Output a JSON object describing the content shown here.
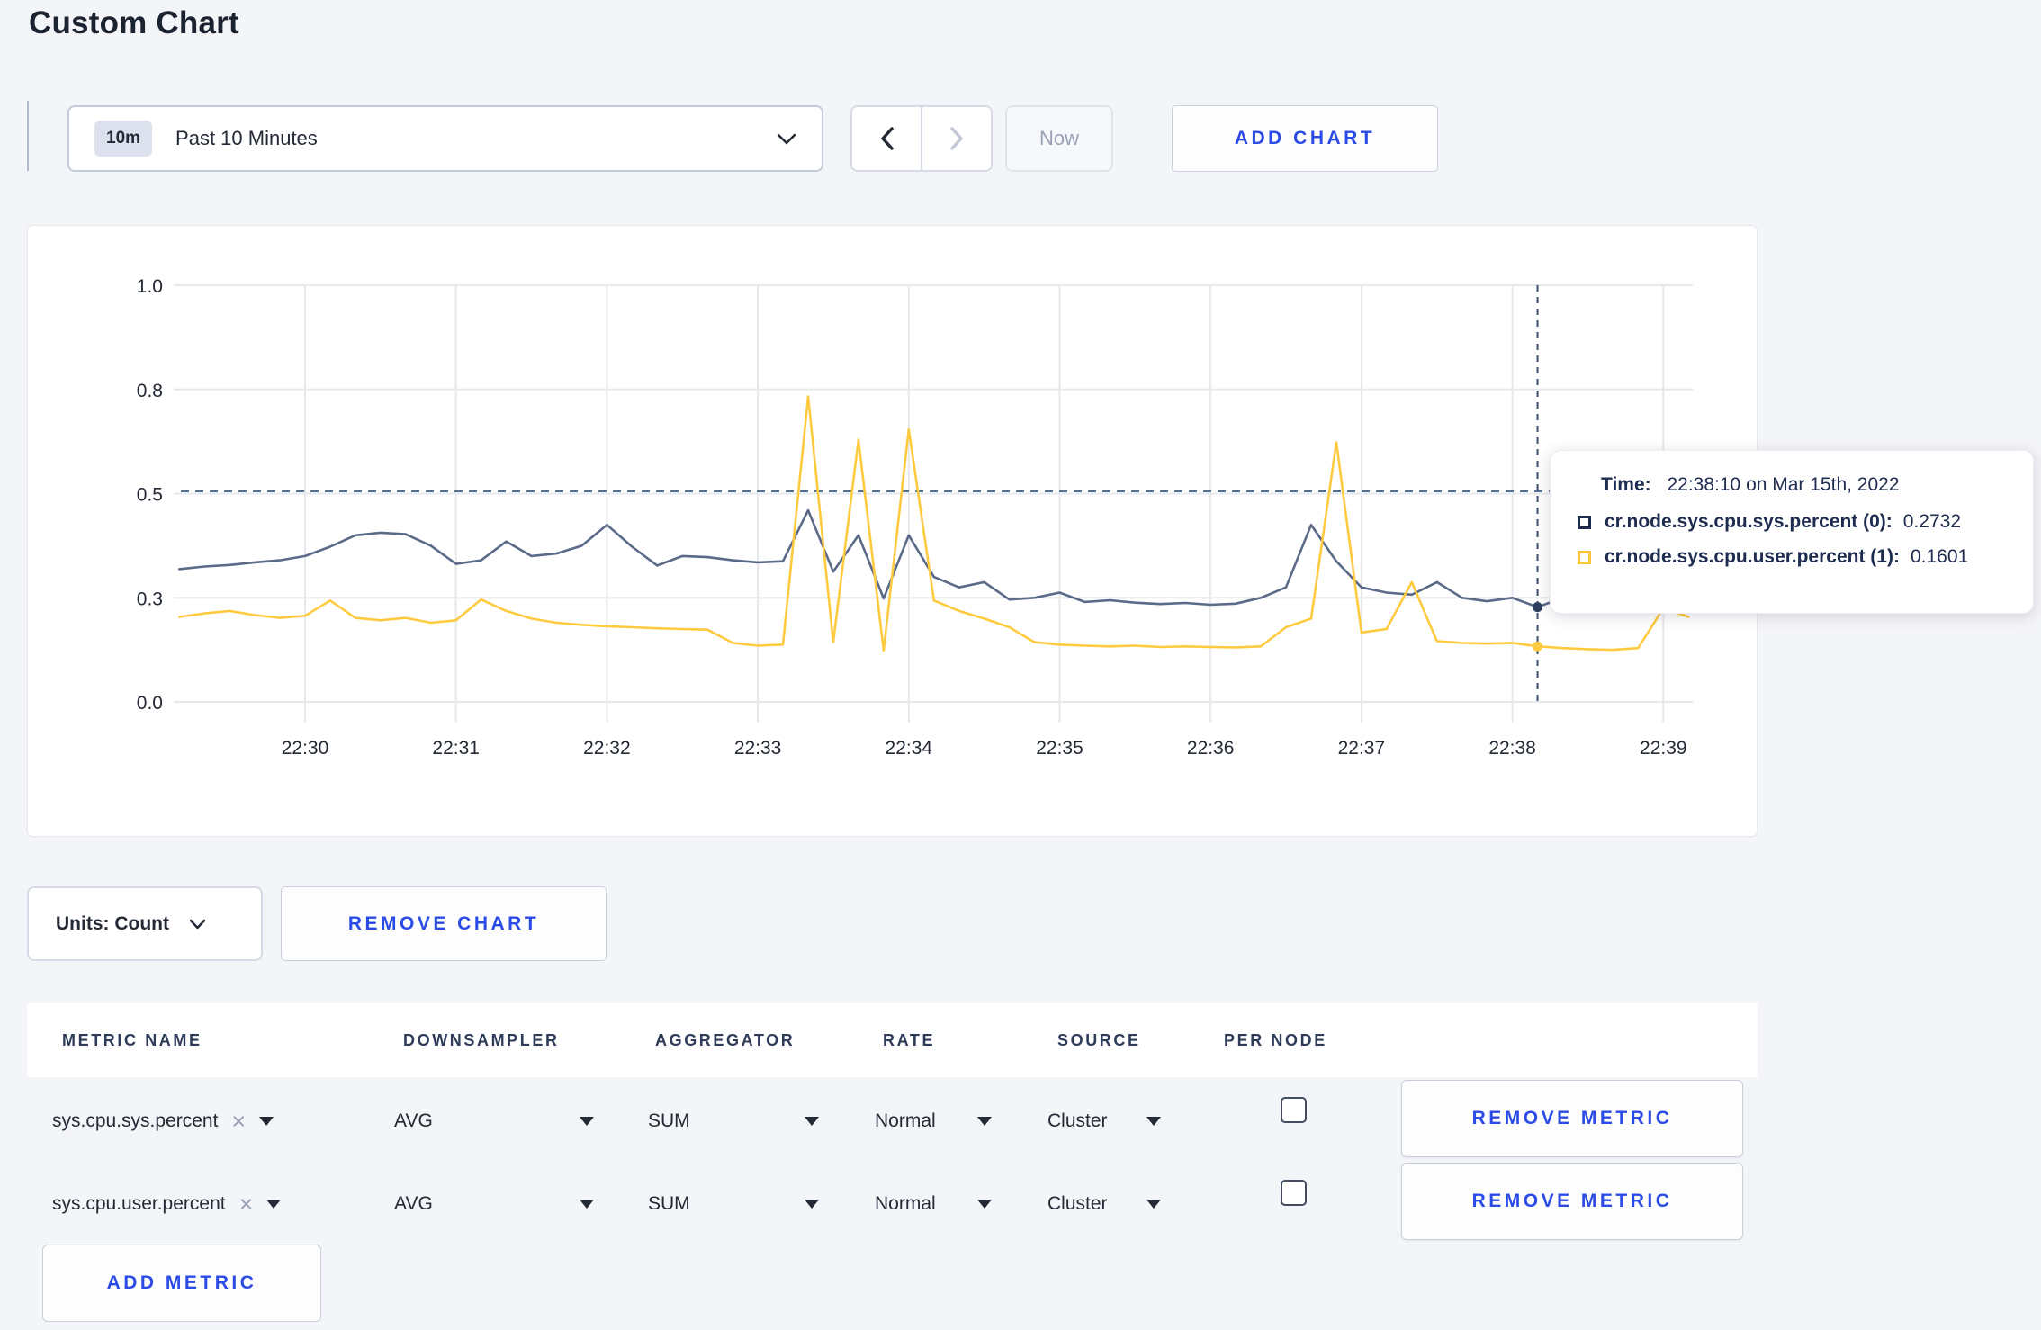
{
  "page": {
    "title": "Custom Chart"
  },
  "toolbar": {
    "time_badge": "10m",
    "time_label": "Past 10 Minutes",
    "now_label": "Now",
    "add_chart_label": "ADD CHART"
  },
  "chart_data": {
    "type": "line",
    "title": "",
    "xlabel": "",
    "ylabel": "",
    "ylim": [
      0.0,
      1.0
    ],
    "grid": true,
    "y_ticks": {
      "values": [
        1.0,
        0.8,
        0.5,
        0.3,
        0.0
      ],
      "labels": [
        "1.0",
        "0.8",
        "0.5",
        "0.3",
        "0.0"
      ]
    },
    "x_ticks": [
      "22:30",
      "22:31",
      "22:32",
      "22:33",
      "22:34",
      "22:35",
      "22:36",
      "22:37",
      "22:38",
      "22:39"
    ],
    "time_start": "22:29:10",
    "time_step_seconds": 10,
    "series": [
      {
        "name": "cr.node.sys.cpu.sys.percent (0)",
        "color": "#5a6a88",
        "values": [
          0.355,
          0.36,
          0.363,
          0.368,
          0.372,
          0.38,
          0.398,
          0.42,
          0.425,
          0.422,
          0.4,
          0.365,
          0.372,
          0.408,
          0.38,
          0.385,
          0.4,
          0.44,
          0.398,
          0.362,
          0.38,
          0.378,
          0.372,
          0.368,
          0.37,
          0.468,
          0.35,
          0.42,
          0.298,
          0.42,
          0.34,
          0.32,
          0.33,
          0.295,
          0.3,
          0.31,
          0.288,
          0.293,
          0.286,
          0.282,
          0.285,
          0.28,
          0.283,
          0.3,
          0.32,
          0.44,
          0.37,
          0.32,
          0.31,
          0.306,
          0.33,
          0.3,
          0.29,
          0.3,
          0.2732,
          0.3,
          0.31,
          0.325,
          0.305,
          0.298,
          0.32
        ]
      },
      {
        "name": "cr.node.sys.cpu.user.percent (1)",
        "color": "#fdca40",
        "values": [
          0.245,
          0.255,
          0.262,
          0.25,
          0.242,
          0.248,
          0.292,
          0.242,
          0.235,
          0.242,
          0.228,
          0.235,
          0.295,
          0.262,
          0.24,
          0.228,
          0.222,
          0.218,
          0.215,
          0.212,
          0.21,
          0.208,
          0.17,
          0.162,
          0.165,
          0.78,
          0.172,
          0.655,
          0.148,
          0.685,
          0.292,
          0.262,
          0.24,
          0.215,
          0.172,
          0.165,
          0.162,
          0.16,
          0.162,
          0.158,
          0.16,
          0.158,
          0.157,
          0.16,
          0.215,
          0.24,
          0.648,
          0.2,
          0.21,
          0.33,
          0.175,
          0.17,
          0.168,
          0.17,
          0.1601,
          0.155,
          0.152,
          0.15,
          0.155,
          0.27,
          0.245
        ]
      }
    ],
    "crosshair": {
      "index": 54,
      "time": "22:38:10",
      "hline_value": 0.507
    },
    "colors": {
      "gridline": "#e7e8eb",
      "crosshair_v": "#3d4f6d",
      "crosshair_h": "#4e7195",
      "dot_sys": "#2c3d5e",
      "dot_user": "#fdca40"
    },
    "legend_position": "tooltip"
  },
  "tooltip": {
    "time_label": "Time:",
    "time_value": "22:38:10 on Mar 15th, 2022",
    "series": [
      {
        "label": "cr.node.sys.cpu.sys.percent (0):",
        "value": "0.2732",
        "color": "#1c2b4a"
      },
      {
        "label": "cr.node.sys.cpu.user.percent (1):",
        "value": "0.1601",
        "color": "#fdc53a"
      }
    ]
  },
  "chart_footer": {
    "units_label": "Units: Count",
    "remove_chart_label": "REMOVE CHART"
  },
  "metrics_table": {
    "headers": [
      "METRIC NAME",
      "DOWNSAMPLER",
      "AGGREGATOR",
      "RATE",
      "SOURCE",
      "PER NODE"
    ],
    "rows": [
      {
        "metric": "sys.cpu.sys.percent",
        "downsampler": "AVG",
        "aggregator": "SUM",
        "rate": "Normal",
        "source": "Cluster",
        "per_node_checked": false,
        "remove_label": "REMOVE METRIC"
      },
      {
        "metric": "sys.cpu.user.percent",
        "downsampler": "AVG",
        "aggregator": "SUM",
        "rate": "Normal",
        "source": "Cluster",
        "per_node_checked": false,
        "remove_label": "REMOVE METRIC"
      }
    ],
    "add_metric_label": "ADD METRIC",
    "clear_icon": "×"
  }
}
